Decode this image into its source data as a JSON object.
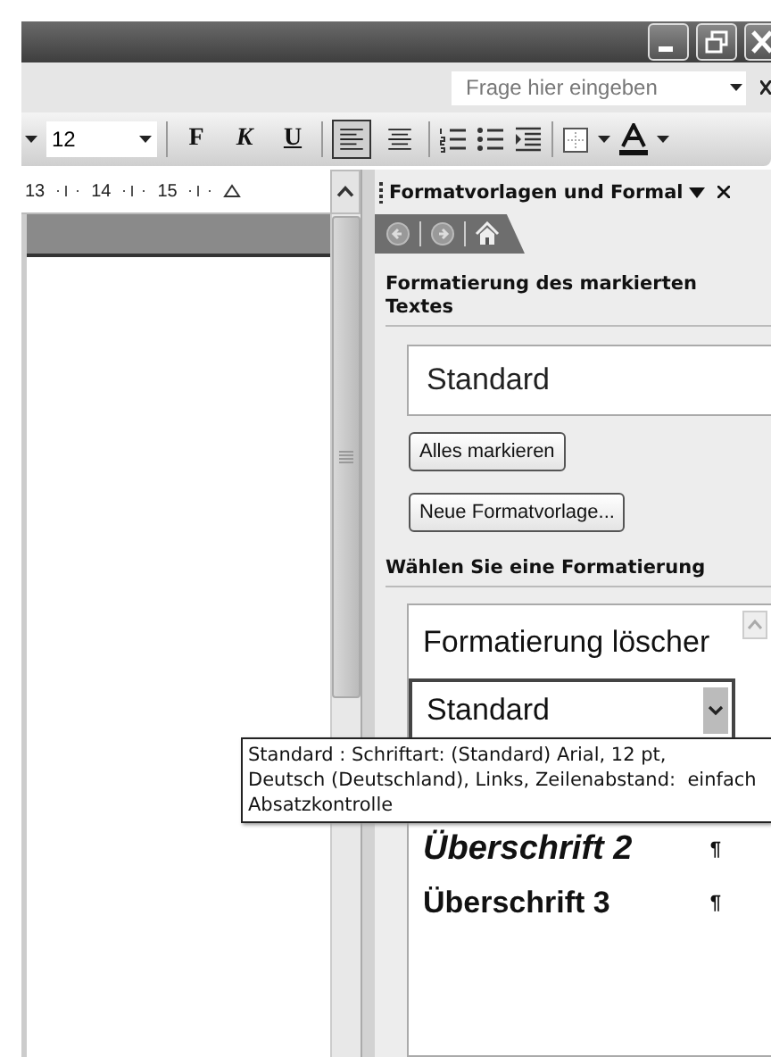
{
  "help_search": {
    "placeholder": "Frage hier eingeben"
  },
  "formatting_toolbar": {
    "font_size": "12",
    "text_buttons": [
      {
        "label": "F",
        "kind": "bold",
        "selected": false
      },
      {
        "label": "K",
        "kind": "italic",
        "selected": false
      },
      {
        "label": "U",
        "kind": "underline",
        "selected": false
      }
    ],
    "align_buttons": [
      {
        "kind": "left",
        "selected": true
      },
      {
        "kind": "center",
        "selected": false
      }
    ]
  },
  "ruler": {
    "labels": [
      "13",
      "14",
      "15"
    ]
  },
  "task_pane": {
    "title": "Formatvorlagen und Formal",
    "selection_heading": "Formatierung des markierten Textes",
    "current_style": "Standard",
    "buttons": [
      "Alles markieren",
      "Neue Formatvorlage..."
    ],
    "choose_heading": "Wählen Sie eine Formatierung",
    "styles": [
      {
        "label": "Formatierung löscher",
        "kind": "plain",
        "selected": false
      },
      {
        "label": "Standard",
        "kind": "plain",
        "selected": true
      },
      {
        "label": "Überschrift 2",
        "kind": "heading2",
        "selected": false,
        "mark": "¶"
      },
      {
        "label": "Überschrift 3",
        "kind": "heading3",
        "selected": false,
        "mark": "¶"
      }
    ]
  },
  "tooltip": {
    "lines": [
      "Standard : Schriftart: (Standard) Arial, 12 pt,",
      "Deutsch (Deutschland), Links, Zeilenabstand:  einfach",
      "Absatzkontrolle"
    ]
  }
}
